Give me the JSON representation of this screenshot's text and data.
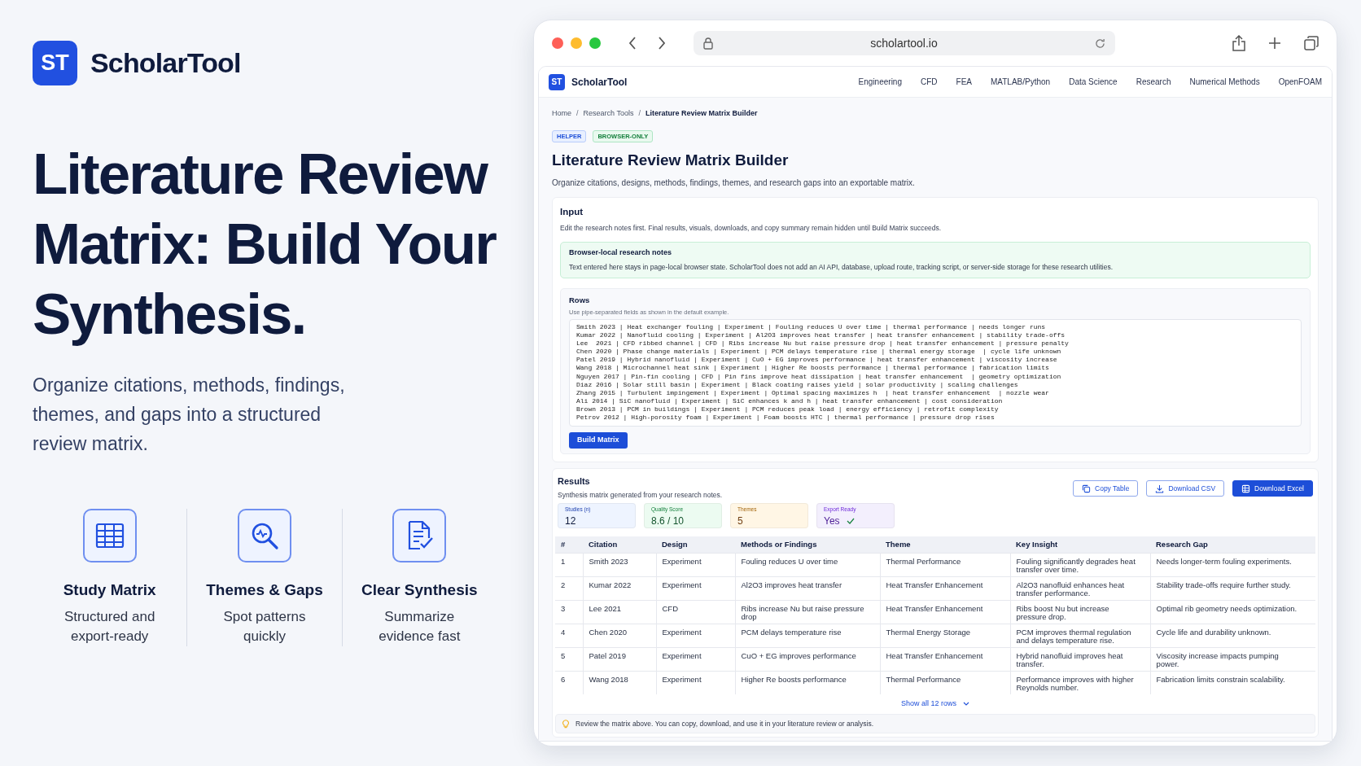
{
  "brand": {
    "initials": "ST",
    "name": "ScholarTool"
  },
  "headline": "Literature Review Matrix: Build Your Synthesis.",
  "subtitle": "Organize citations, methods, findings, themes, and gaps into a structured review matrix.",
  "features": [
    {
      "kind": "grid",
      "title": "Study Matrix",
      "text": "Structured and export-ready"
    },
    {
      "kind": "search",
      "title": "Themes & Gaps",
      "text": "Spot patterns quickly"
    },
    {
      "kind": "document",
      "title": "Clear Synthesis",
      "text": "Summarize evidence fast"
    }
  ],
  "browser": {
    "url": "scholartool.io"
  },
  "site": {
    "initials": "ST",
    "name": "ScholarTool",
    "nav": [
      "Engineering",
      "CFD",
      "FEA",
      "MATLAB/Python",
      "Data Science",
      "Research",
      "Numerical Methods",
      "OpenFOAM"
    ],
    "breadcrumb_separator": "/",
    "breadcrumb": [
      {
        "label": "Home",
        "current": false
      },
      {
        "label": "Research Tools",
        "current": false
      },
      {
        "label": "Literature Review Matrix Builder",
        "current": true
      }
    ],
    "badges": [
      {
        "label": "HELPER",
        "kind": "info"
      },
      {
        "label": "BROWSER-ONLY",
        "kind": "success"
      }
    ],
    "title": "Literature Review Matrix Builder",
    "description": "Organize citations, designs, methods, findings, themes, and research gaps into an exportable matrix.",
    "input": {
      "title": "Input",
      "description": "Edit the research notes first. Final results, visuals, downloads, and copy summary remain hidden until Build Matrix succeeds.",
      "note": {
        "title": "Browser-local research notes",
        "text": "Text entered here stays in page-local browser state. ScholarTool does not add an AI API, database, upload route, tracking script, or server-side storage for these research utilities."
      },
      "rows": {
        "label": "Rows",
        "hint": "Use pipe-separated fields as shown in the default example.",
        "value": "Smith 2023 | Heat exchanger fouling | Experiment | Fouling reduces U over time | thermal performance | needs longer runs\nKumar 2022 | Nanofluid cooling | Experiment | Al2O3 improves heat transfer | heat transfer enhancement | stability trade-offs\nLee  2021 | CFD ribbed channel | CFD | Ribs increase Nu but raise pressure drop | heat transfer enhancement | pressure penalty\nChen 2020 | Phase change materials | Experiment | PCM delays temperature rise | thermal energy storage  | cycle life unknown\nPatel 2019 | Hybrid nanofluid | Experiment | CuO + EG improves performance | heat transfer enhancement | viscosity increase\nWang 2018 | Microchannel heat sink | Experiment | Higher Re boosts performance | thermal performance | fabrication limits\nNguyen 2017 | Pin-fin cooling | CFD | Pin fins improve heat dissipation | heat transfer enhancement  | geometry optimization\nDiaz 2016 | Solar still basin | Experiment | Black coating raises yield | solar productivity | scaling challenges\nZhang 2015 | Turbulent impingement | Experiment | Optimal spacing maximizes h  | heat transfer enhancement  | nozzle wear\nAli 2014 | SiC nanofluid | Experiment | SiC enhances k and h | heat transfer enhancement | cost consideration\nBrown 2013 | PCM in buildings | Experiment | PCM reduces peak load | energy efficiency | retrofit complexity\nPetrov 2012 | High-porosity foam | Experiment | Foam boosts HTC | thermal performance | pressure drop rises"
      },
      "button": "Build Matrix"
    },
    "results": {
      "title": "Results",
      "description": "Synthesis matrix generated from your research notes.",
      "actions": [
        {
          "label": "Copy Table",
          "kind": "copy",
          "primary": false
        },
        {
          "label": "Download CSV",
          "kind": "download",
          "primary": false
        },
        {
          "label": "Download Excel",
          "kind": "excel",
          "primary": true
        }
      ],
      "stats": [
        {
          "label": "Studies (n)",
          "value": "12",
          "color": "#eef4ff",
          "checked": false
        },
        {
          "label": "Quality Score",
          "value": "8.6 / 10",
          "color": "#ecfbf1",
          "checked": false
        },
        {
          "label": "Themes",
          "value": "5",
          "color": "#fff6e5",
          "checked": false
        },
        {
          "label": "Export Ready",
          "value": "Yes",
          "color": "#f3effd",
          "checked": true
        }
      ],
      "table": {
        "columns": [
          "#",
          "Citation",
          "Design",
          "Methods or Findings",
          "Theme",
          "Key Insight",
          "Research Gap"
        ],
        "rows": [
          [
            "1",
            "Smith 2023",
            "Experiment",
            "Fouling reduces U over time",
            "Thermal Performance",
            "Fouling significantly degrades heat transfer over time.",
            "Needs longer-term fouling experiments."
          ],
          [
            "2",
            "Kumar 2022",
            "Experiment",
            "Al2O3 improves heat transfer",
            "Heat Transfer Enhancement",
            "Al2O3 nanofluid enhances heat transfer performance.",
            "Stability trade-offs require further study."
          ],
          [
            "3",
            "Lee 2021",
            "CFD",
            "Ribs increase Nu but raise pressure drop",
            "Heat Transfer Enhancement",
            "Ribs boost Nu but increase pressure drop.",
            "Optimal rib geometry needs optimization."
          ],
          [
            "4",
            "Chen 2020",
            "Experiment",
            "PCM delays temperature rise",
            "Thermal Energy Storage",
            "PCM improves thermal regulation and delays temperature rise.",
            "Cycle life and durability unknown."
          ],
          [
            "5",
            "Patel 2019",
            "Experiment",
            "CuO + EG improves performance",
            "Heat Transfer Enhancement",
            "Hybrid nanofluid improves heat transfer.",
            "Viscosity increase impacts pumping power."
          ],
          [
            "6",
            "Wang 2018",
            "Experiment",
            "Higher Re boosts performance",
            "Thermal Performance",
            "Performance improves with higher Reynolds number.",
            "Fabrication limits constrain scalability."
          ]
        ]
      },
      "show_all": "Show all 12 rows",
      "tip": "Review the matrix above. You can copy, download, and use it in your literature review or analysis."
    }
  }
}
